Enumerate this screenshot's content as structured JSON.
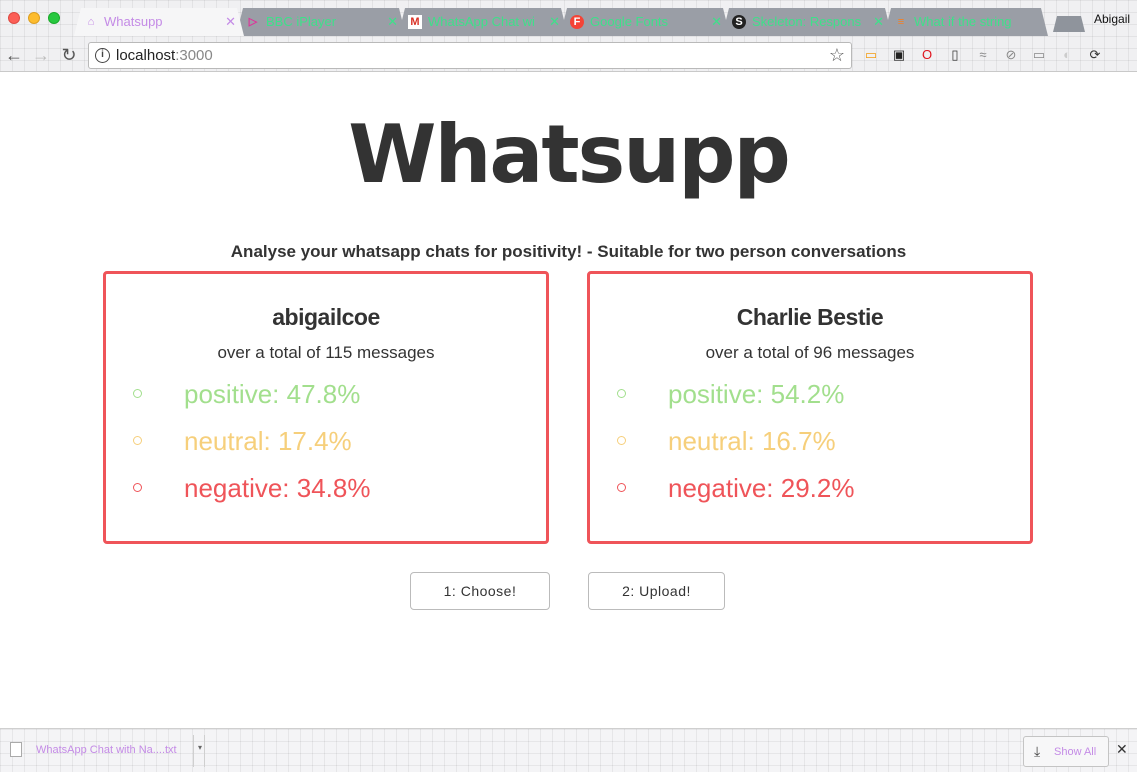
{
  "browser": {
    "tabs": [
      {
        "title": "Whatsupp",
        "favicon": "github-icon",
        "favicon_glyph": "⌂",
        "active": true
      },
      {
        "title": "BBC iPlayer",
        "favicon": "play-icon",
        "favicon_glyph": "▷"
      },
      {
        "title": "WhatsApp Chat wi",
        "favicon": "gmail-icon",
        "favicon_glyph": "M"
      },
      {
        "title": "Google Fonts",
        "favicon": "google-fonts-icon",
        "favicon_glyph": "F"
      },
      {
        "title": "Skeleton: Respons",
        "favicon": "skeleton-icon",
        "favicon_glyph": "S"
      },
      {
        "title": "What if the string",
        "favicon": "stackoverflow-icon",
        "favicon_glyph": "≡"
      }
    ],
    "tab_close_glyph": "✕",
    "profile_name": "Abigail",
    "address": {
      "host": "localhost",
      "port": ":3000"
    },
    "icons": {
      "back": "←",
      "forward": "→",
      "reload": "↻",
      "info": "i",
      "star": "☆"
    },
    "extensions": [
      {
        "name": "cast-icon",
        "glyph": "▭",
        "color": "#f39c12"
      },
      {
        "name": "tampermonkey-icon",
        "glyph": "▣",
        "color": "#222222"
      },
      {
        "name": "opera-icon",
        "glyph": "O",
        "color": "#e0141e"
      },
      {
        "name": "mobile-icon",
        "glyph": "▯",
        "color": "#333333"
      },
      {
        "name": "wave-icon",
        "glyph": "≈",
        "color": "#888888"
      },
      {
        "name": "block-icon",
        "glyph": "⊘",
        "color": "#888888"
      },
      {
        "name": "screen-icon",
        "glyph": "▭",
        "color": "#888888"
      },
      {
        "name": "circle-icon",
        "glyph": "◐",
        "color": "#cccccc"
      },
      {
        "name": "sync-icon",
        "glyph": "⟳",
        "color": "#333333"
      }
    ]
  },
  "page": {
    "logo": "Whatsupp",
    "tagline": "Analyse your whatsapp chats for positivity! - Suitable for two person conversations",
    "people": [
      {
        "name": "abigailcoe",
        "total": "over a total of 115 messages",
        "positive": "positive: 47.8%",
        "neutral": "neutral: 17.4%",
        "negative": "negative: 34.8%"
      },
      {
        "name": "Charlie Bestie",
        "total": "over a total of 96 messages",
        "positive": "positive: 54.2%",
        "neutral": "neutral: 16.7%",
        "negative": "negative: 29.2%"
      }
    ],
    "choose_label": "1: Choose!",
    "upload_label": "2: Upload!",
    "colors": {
      "positive": "#a2df8d",
      "neutral": "#f6cf7b",
      "negative": "#ef5459"
    }
  },
  "downloads": {
    "file_name": "WhatsApp Chat with Na....txt",
    "menu_glyph": "▾",
    "show_all_label": "Show All",
    "download_glyph": "⤓",
    "close_glyph": "✕"
  }
}
